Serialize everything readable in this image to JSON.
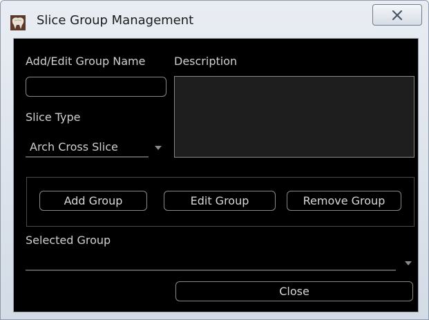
{
  "window": {
    "title": "Slice Group Management",
    "app_icon": "dental-app-icon",
    "close_icon": "close-icon"
  },
  "form": {
    "group_name_label": "Add/Edit Group Name",
    "group_name_value": "",
    "description_label": "Description",
    "description_value": "",
    "slice_type_label": "Slice Type",
    "slice_type_selected": "Arch Cross Slice",
    "selected_group_label": "Selected Group",
    "selected_group_value": ""
  },
  "buttons": {
    "add_group": "Add Group",
    "edit_group": "Edit Group",
    "remove_group": "Remove Group",
    "close": "Close"
  }
}
